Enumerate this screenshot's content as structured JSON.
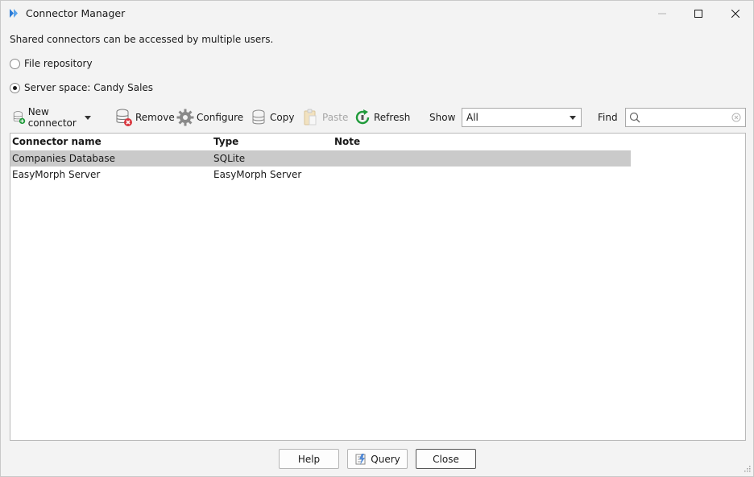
{
  "window": {
    "title": "Connector Manager"
  },
  "description": "Shared connectors can be accessed by multiple users.",
  "storage": {
    "options": [
      {
        "label": "File repository",
        "checked": false
      },
      {
        "label": "Server space: Candy Sales",
        "checked": true
      }
    ]
  },
  "toolbar": {
    "new_connector": "New connector",
    "remove": "Remove",
    "configure": "Configure",
    "copy": "Copy",
    "paste": "Paste",
    "refresh": "Refresh"
  },
  "filter": {
    "show_label": "Show",
    "show_value": "All",
    "find_label": "Find",
    "find_value": ""
  },
  "table": {
    "columns": [
      "Connector name",
      "Type",
      "Note"
    ],
    "rows": [
      {
        "name": "Companies Database",
        "type": "SQLite",
        "note": "",
        "selected": true
      },
      {
        "name": "EasyMorph Server",
        "type": "EasyMorph Server",
        "note": "",
        "selected": false
      }
    ]
  },
  "buttons": {
    "help": "Help",
    "query": "Query",
    "close": "Close"
  },
  "colors": {
    "accent": "#2b7bd6",
    "selected_row": "#cacaca",
    "add_green": "#1f9a3a",
    "remove_red": "#d9363e"
  }
}
